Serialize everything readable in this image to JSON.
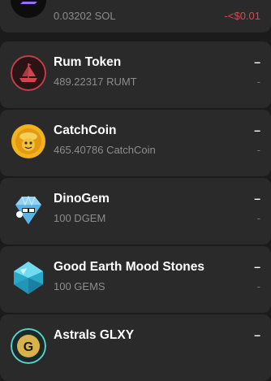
{
  "tokens": [
    {
      "name": "",
      "balance": "0.03202 SOL",
      "value": "",
      "change": "-<$0.01",
      "change_color": "#e0454e",
      "icon": "solana-logo-icon"
    },
    {
      "name": "Rum Token",
      "balance": "489.22317 RUMT",
      "value": "–",
      "change": "-",
      "icon": "pirate-ship-icon"
    },
    {
      "name": "CatchCoin",
      "balance": "465.40786 CatchCoin",
      "value": "–",
      "change": "-",
      "icon": "catchcoin-icon"
    },
    {
      "name": "DinoGem",
      "balance": "100 DGEM",
      "value": "–",
      "change": "-",
      "icon": "dinogem-icon"
    },
    {
      "name": "Good Earth Mood Stones",
      "balance": "100 GEMS",
      "value": "–",
      "change": "-",
      "icon": "gem-stone-icon"
    },
    {
      "name": "Astrals GLXY",
      "balance": "",
      "value": "–",
      "change": "",
      "icon": "astrals-logo-icon"
    }
  ]
}
